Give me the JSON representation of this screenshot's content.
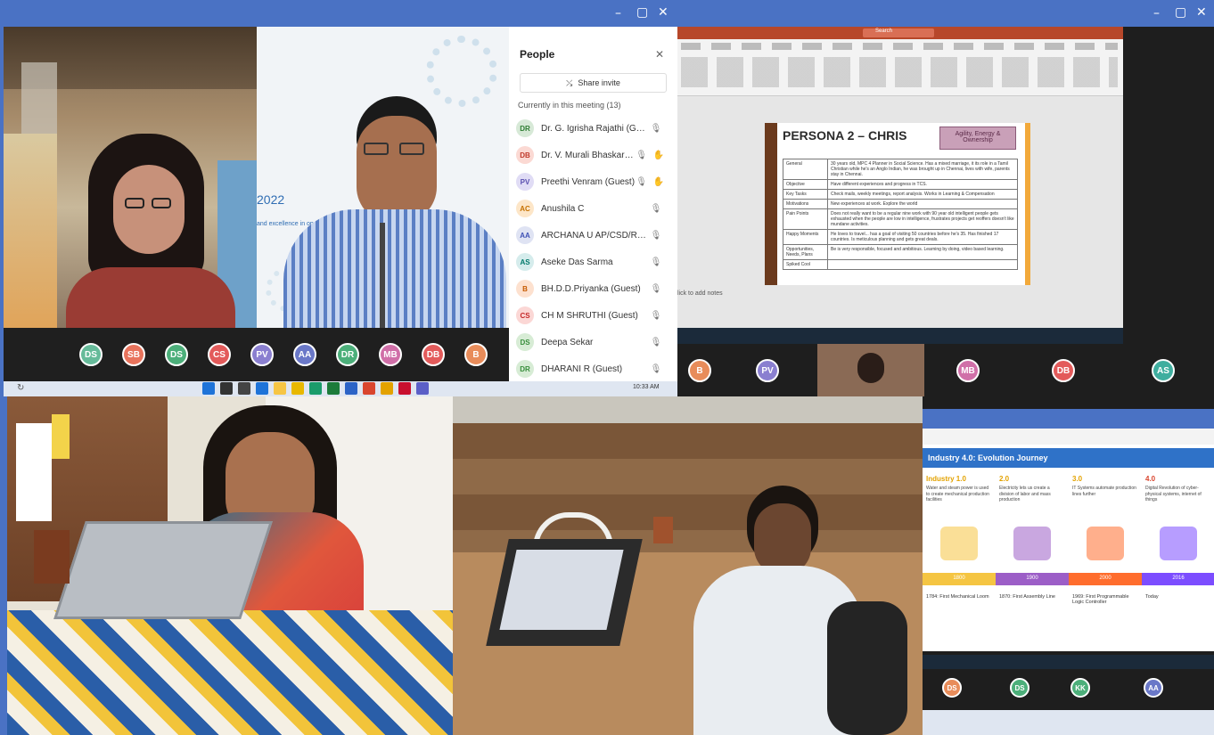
{
  "window": {
    "minimize": "–",
    "maximize": "▢",
    "close": "✕"
  },
  "main_meeting": {
    "conference_year": "2022",
    "conference_tagline": "and excellence in operatio",
    "people_panel": {
      "title": "People",
      "close": "✕",
      "share_invite": "Share invite",
      "section": "Currently in this meeting (13)",
      "participants": [
        {
          "initials": "DR",
          "name": "Dr. G. Igrisha Rajathi (Guest)",
          "color": "#d7e9d7",
          "fg": "#2e7d32",
          "hand": false
        },
        {
          "initials": "DB",
          "name": "Dr. V. Murali Bhaskara...",
          "color": "#fbd9d3",
          "fg": "#c0392b",
          "hand": true
        },
        {
          "initials": "PV",
          "name": "Preethi Venram (Guest)",
          "color": "#e0dcf5",
          "fg": "#5a4fb0",
          "hand": true
        },
        {
          "initials": "AC",
          "name": "Anushila C",
          "color": "#fde6c8",
          "fg": "#c67100",
          "hand": false
        },
        {
          "initials": "AA",
          "name": "ARCHANA U AP/CSD/RMK (...",
          "color": "#dfe3f3",
          "fg": "#3f51b5",
          "hand": false
        },
        {
          "initials": "AS",
          "name": "Aseke Das Sarma",
          "color": "#d5ecec",
          "fg": "#00796b",
          "hand": false
        },
        {
          "initials": "B",
          "name": "BH.D.D.Priyanka (Guest)",
          "color": "#fde1cf",
          "fg": "#c65a00",
          "hand": false
        },
        {
          "initials": "CS",
          "name": "CH M SHRUTHI (Guest)",
          "color": "#fbd7d5",
          "fg": "#c62828",
          "hand": false
        },
        {
          "initials": "DS",
          "name": "Deepa Sekar",
          "color": "#d7ecd5",
          "fg": "#388e3c",
          "hand": false
        },
        {
          "initials": "DR",
          "name": "DHARANI R (Guest)",
          "color": "#d7ecd5",
          "fg": "#388e3c",
          "hand": false
        }
      ]
    },
    "avatar_bar": [
      {
        "initials": "DS",
        "color": "#66bb9a"
      },
      {
        "initials": "SB",
        "color": "#e8735c"
      },
      {
        "initials": "DS",
        "color": "#4caf7a"
      },
      {
        "initials": "CS",
        "color": "#e35b5b"
      },
      {
        "initials": "PV",
        "color": "#8a7fd0"
      },
      {
        "initials": "AA",
        "color": "#6a78c8"
      },
      {
        "initials": "DR",
        "color": "#4caf7a"
      },
      {
        "initials": "MB",
        "color": "#d06fa8"
      },
      {
        "initials": "DB",
        "color": "#e35b5b"
      },
      {
        "initials": "B",
        "color": "#e88c5a"
      }
    ],
    "taskbar_time": "10:33 AM"
  },
  "slide_share": {
    "ppt_search": "Search",
    "slide_title": "PERSONA 2 – CHRIS",
    "slide_badge": "Agility, Energy & Ownership",
    "table_rows": [
      [
        "General",
        "30 years old, MPC 4 Planner in Social Science. Has a mixed marriage, it its role in a Tamil Christian while he's an Anglo Indian, he was brought up in Chennai, lives with wife, parents stay in Chennai."
      ],
      [
        "Objective",
        "Have different experiences and progress in TCS."
      ],
      [
        "Key Tasks",
        "Check mails, weekly meetings, report analysis. Works in Learning & Compensation"
      ],
      [
        "Motivations",
        "New experiences at work. Explore the world"
      ],
      [
        "Pain Points",
        "Does not really want to be a regular nine work with 90 year old intelligent people gets exhausted when the people are low in intelligence, frustrates projects get reoffers doesn't like mundane activities."
      ],
      [
        "Happy Moments",
        "He loves to travel... has a goal of visiting 50 countries before he's 35. Has finished 17 countries. Is meticulous planning and gets great deals."
      ],
      [
        "Opportunities, Needs, Plans",
        "Be is very responsible, focused and ambitious. Learning by doing, video based learning."
      ],
      [
        "Spiked Cool",
        ""
      ]
    ],
    "notes_hint": "lick to add notes",
    "avatars": [
      {
        "initials": "B",
        "color": "#e88c5a"
      },
      {
        "initials": "PV",
        "color": "#8a7fd0"
      },
      {
        "initials": "MB",
        "color": "#d06fa8"
      },
      {
        "initials": "DB",
        "color": "#e35b5b"
      },
      {
        "initials": "AS",
        "color": "#3fae9f"
      }
    ]
  },
  "industry_share": {
    "slide_title": "Industry 4.0: Evolution Journey",
    "stages": [
      {
        "label": "Industry 1.0",
        "desc": "Water and steam power is used to create mechanical production facilities",
        "year": "1800",
        "caption": "1784: First Mechanical Loom",
        "color": "#f5c542"
      },
      {
        "label": "2.0",
        "desc": "Electricity lets us create a division of labor and mass production",
        "year": "1900",
        "caption": "1870: First Assembly Line",
        "color": "#9c5ec7"
      },
      {
        "label": "3.0",
        "desc": "IT Systems automate production lines further",
        "year": "2000",
        "caption": "1969: First Programmable Logic Controller",
        "color": "#ff6d2d"
      },
      {
        "label": "4.0",
        "desc": "Digital Revolution of cyber-physical systems, internet of things",
        "year": "2016",
        "caption": "Today",
        "color": "#7c4dff"
      }
    ],
    "avatars": [
      {
        "initials": "DS",
        "color": "#e88c5a"
      },
      {
        "initials": "DS",
        "color": "#4caf7a"
      },
      {
        "initials": "KK",
        "color": "#4caf7a"
      },
      {
        "initials": "AA",
        "color": "#6a78c8"
      }
    ]
  }
}
